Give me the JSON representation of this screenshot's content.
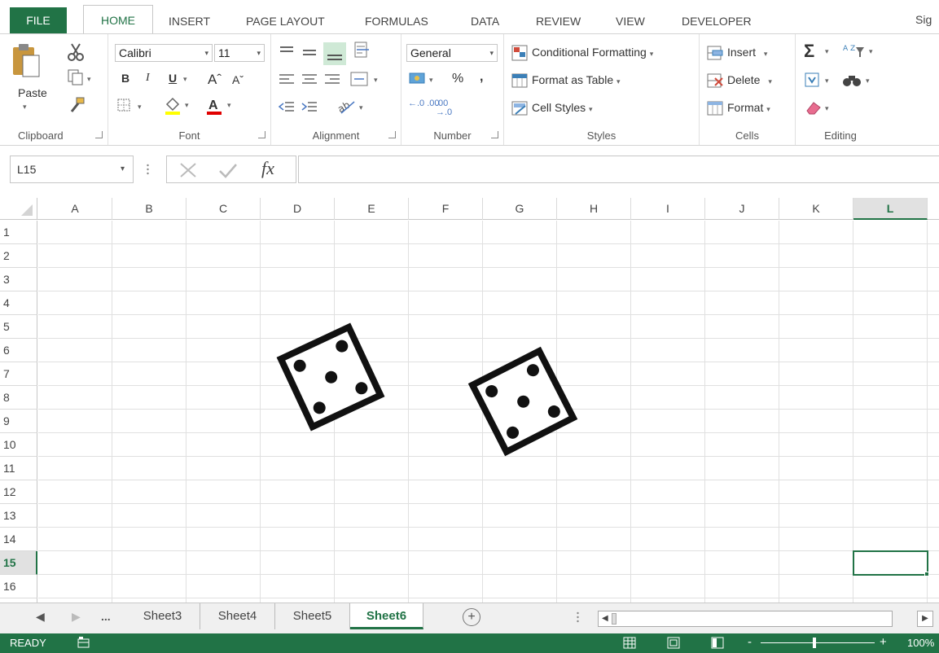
{
  "menu": {
    "file": "FILE",
    "home": "HOME",
    "insert": "INSERT",
    "page_layout": "PAGE LAYOUT",
    "formulas": "FORMULAS",
    "data": "DATA",
    "review": "REVIEW",
    "view": "VIEW",
    "developer": "DEVELOPER",
    "sign_in": "Sig"
  },
  "ribbon": {
    "clipboard": {
      "label": "Clipboard",
      "paste": "Paste"
    },
    "font": {
      "label": "Font",
      "family": "Calibri",
      "size": "11",
      "bold": "B",
      "italic": "I",
      "underline": "U",
      "font_color_letter": "A"
    },
    "alignment": {
      "label": "Alignment"
    },
    "number": {
      "label": "Number",
      "format": "General",
      "percent": "%",
      "comma": ",",
      "inc_decimal": "←.0 .00",
      "dec_decimal": ".00 →.0"
    },
    "styles": {
      "label": "Styles",
      "conditional": "Conditional Formatting",
      "format_table": "Format as Table",
      "cell_styles": "Cell Styles"
    },
    "cells": {
      "label": "Cells",
      "insert": "Insert",
      "delete": "Delete",
      "format": "Format"
    },
    "editing": {
      "label": "Editing",
      "sum": "Σ",
      "sort": "A Z"
    }
  },
  "formula_bar": {
    "name_box": "L15",
    "fx": "fx",
    "value": ""
  },
  "grid": {
    "columns": [
      "A",
      "B",
      "C",
      "D",
      "E",
      "F",
      "G",
      "H",
      "I",
      "J",
      "K",
      "L"
    ],
    "rows": [
      "1",
      "2",
      "3",
      "4",
      "5",
      "6",
      "7",
      "8",
      "9",
      "10",
      "11",
      "12",
      "13",
      "14",
      "15",
      "16"
    ],
    "active_column": "L",
    "active_row": "15"
  },
  "dice": [
    {
      "name": "die-1",
      "face": 5
    },
    {
      "name": "die-2",
      "face": 5
    }
  ],
  "sheets": {
    "ellipsis": "...",
    "tabs": [
      "Sheet3",
      "Sheet4",
      "Sheet5",
      "Sheet6"
    ],
    "active": "Sheet6"
  },
  "status": {
    "text": "READY",
    "zoom": "100%"
  },
  "colors": {
    "accent": "#217346",
    "font_color_bar": "#e00000"
  }
}
